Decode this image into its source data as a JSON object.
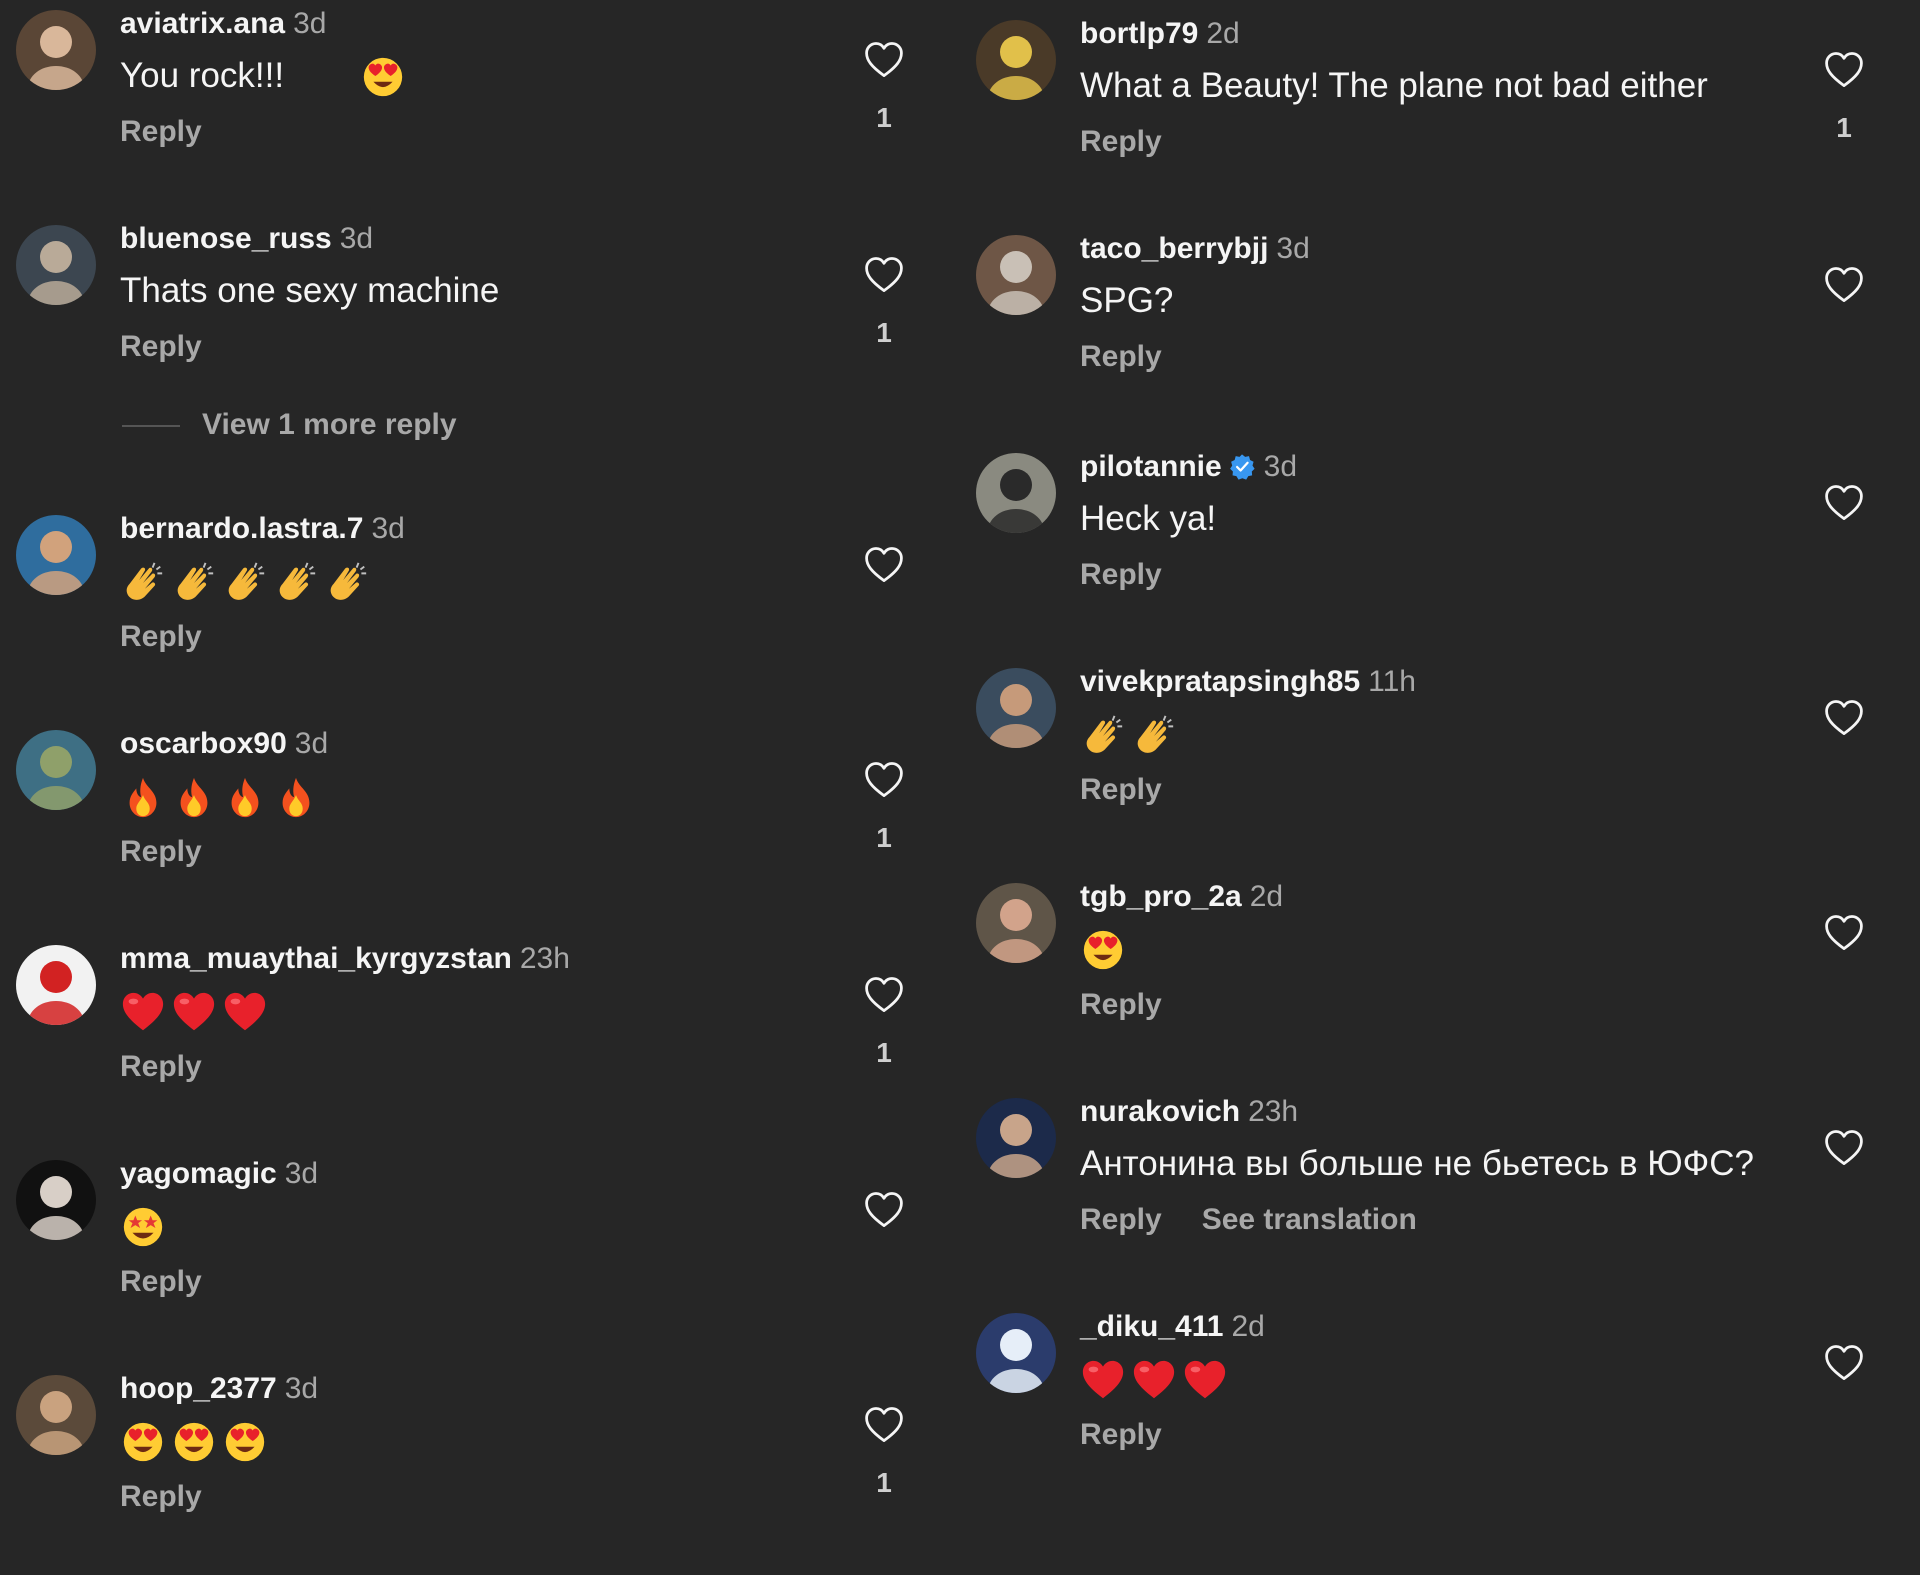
{
  "left_column": {
    "comments": [
      {
        "username": "aviatrix.ana",
        "time": "3d",
        "text": "You rock!!!",
        "emojis": [
          "heart-eyes"
        ],
        "reply": "Reply",
        "likes": "1"
      },
      {
        "username": "bluenose_russ",
        "time": "3d",
        "text": "Thats one sexy machine",
        "emojis": [],
        "reply": "Reply",
        "likes": "1"
      },
      {
        "username": "bernardo.lastra.7",
        "time": "3d",
        "text": "",
        "emojis": [
          "clap",
          "clap",
          "clap",
          "clap",
          "clap"
        ],
        "reply": "Reply",
        "likes": ""
      },
      {
        "username": "oscarbox90",
        "time": "3d",
        "text": "",
        "emojis": [
          "fire",
          "fire",
          "fire",
          "fire"
        ],
        "reply": "Reply",
        "likes": "1"
      },
      {
        "username": "mma_muaythai_kyrgyzstan",
        "time": "23h",
        "text": "",
        "emojis": [
          "red-heart",
          "red-heart",
          "red-heart"
        ],
        "reply": "Reply",
        "likes": "1"
      },
      {
        "username": "yagomagic",
        "time": "3d",
        "text": "",
        "emojis": [
          "star-struck"
        ],
        "reply": "Reply",
        "likes": ""
      },
      {
        "username": "hoop_2377",
        "time": "3d",
        "text": "",
        "emojis": [
          "heart-eyes",
          "heart-eyes",
          "heart-eyes"
        ],
        "reply": "Reply",
        "likes": "1"
      }
    ],
    "view_more_replies": "View 1 more reply"
  },
  "right_column": {
    "comments": [
      {
        "username": "bortlp79",
        "time": "2d",
        "text": "What a Beauty!  The plane not bad either",
        "emojis": [],
        "reply": "Reply",
        "likes": "1"
      },
      {
        "username": "taco_berrybjj",
        "time": "3d",
        "text": "SPG?",
        "emojis": [],
        "reply": "Reply",
        "likes": ""
      },
      {
        "username": "pilotannie",
        "verified": true,
        "time": "3d",
        "text": "Heck ya!",
        "emojis": [],
        "reply": "Reply",
        "likes": ""
      },
      {
        "username": "vivekpratapsingh85",
        "time": "11h",
        "text": "",
        "emojis": [
          "clap",
          "clap"
        ],
        "reply": "Reply",
        "likes": ""
      },
      {
        "username": "tgb_pro_2a",
        "time": "2d",
        "text": "",
        "emojis": [
          "heart-eyes"
        ],
        "reply": "Reply",
        "likes": ""
      },
      {
        "username": "nurakovich",
        "time": "23h",
        "text": "Антонина вы больше не бьетесь в ЮФС?",
        "emojis": [],
        "reply": "Reply",
        "see_translation": "See translation",
        "likes": ""
      },
      {
        "username": "_diku_411",
        "time": "2d",
        "text": "",
        "emojis": [
          "red-heart",
          "red-heart",
          "red-heart"
        ],
        "reply": "Reply",
        "likes": ""
      }
    ]
  },
  "colors": {
    "background": "#262626",
    "primary_text": "#f5f5f5",
    "secondary_text": "#a8a8a8",
    "verified_badge": "#3897f0"
  },
  "icons": {
    "like": "heart-outline-icon",
    "verified": "verified-badge-icon"
  }
}
